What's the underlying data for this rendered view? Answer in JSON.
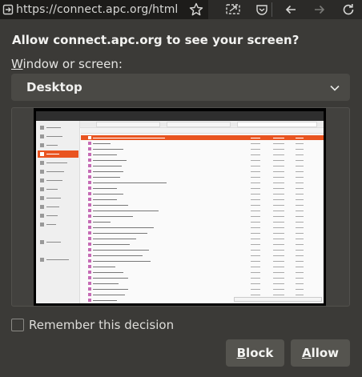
{
  "browser": {
    "url": "https://connect.apc.org/html",
    "icons": [
      "site-info-icon",
      "bookmark-star-icon",
      "screen-share-icon",
      "pocket-icon",
      "back-icon",
      "forward-icon",
      "reload-icon"
    ]
  },
  "dialog": {
    "title": "Allow connect.apc.org to see your screen?",
    "window_label_mnemonic": "W",
    "window_label_rest": "indow or screen:",
    "selected_source": "Desktop",
    "remember_label": "Remember this decision",
    "remember_checked": false,
    "block_mnemonic": "B",
    "block_rest": "lock",
    "allow_mnemonic": "A",
    "allow_rest": "llow"
  },
  "colors": {
    "accent": "#e95420",
    "dialog_bg": "#3b3a37",
    "button_bg": "#55544f"
  }
}
